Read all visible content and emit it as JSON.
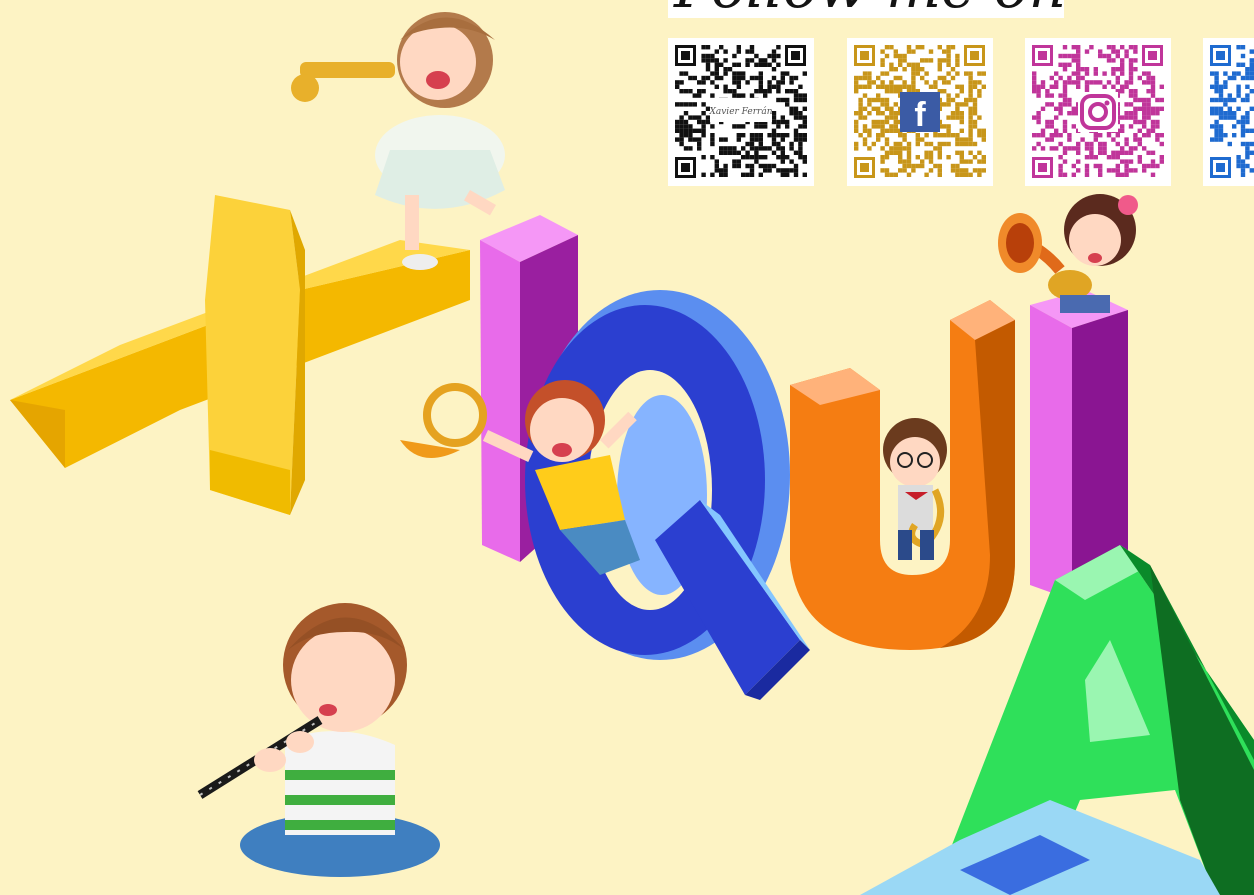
{
  "banner": {
    "text": "Follow me on"
  },
  "qr_codes": [
    {
      "name": "website-qr",
      "color": "#111111",
      "center_icon": "signature-logo",
      "logo_text": "Xavier Ferrán"
    },
    {
      "name": "facebook-qr",
      "color": "#c8961a",
      "center_icon": "facebook-icon",
      "logo_text": "f"
    },
    {
      "name": "instagram-qr",
      "color": "#c0359a",
      "center_icon": "instagram-icon",
      "logo_text": ""
    },
    {
      "name": "fourth-qr",
      "color": "#1f6bd0",
      "center_icon": "",
      "logo_text": ""
    }
  ],
  "colors": {
    "background": "#fdf3c4",
    "letter_x": "#fcd23a",
    "letter_i": "#e86bea",
    "letter_q": "#2b3fd0",
    "letter_u": "#f57d12",
    "letter_a": "#2fe05a",
    "letter_bottom": "#9ad8f5"
  },
  "scene": {
    "letters": [
      "X",
      "I",
      "Q",
      "U",
      "I",
      "A"
    ],
    "characters": [
      "girl-with-trumpet",
      "boy-with-horn",
      "boy-with-saxophone",
      "girl-with-tuba",
      "boy-with-clarinet"
    ]
  }
}
